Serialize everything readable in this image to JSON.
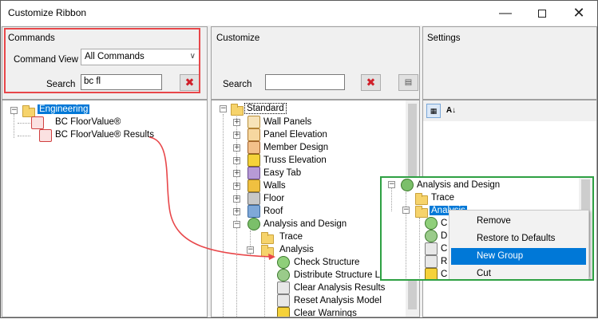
{
  "window": {
    "title": "Customize Ribbon",
    "min_icon": "minimize-icon",
    "max_icon": "maximize-icon",
    "close_icon": "close-icon"
  },
  "commands": {
    "header": "Commands",
    "command_view_label": "Command View",
    "command_view_value": "All Commands",
    "search_label": "Search",
    "search_value": "bc fl",
    "tree": {
      "root": "Engineering",
      "items": [
        "BC FloorValue®",
        "BC FloorValue® Results"
      ]
    }
  },
  "customize": {
    "header": "Customize",
    "search_label": "Search",
    "search_value": "",
    "tree": {
      "root": "Standard",
      "groups": [
        "Wall Panels",
        "Panel Elevation",
        "Member Design",
        "Truss Elevation",
        "Easy Tab",
        "Walls",
        "Floor",
        "Roof"
      ],
      "analysis_design": "Analysis and Design",
      "trace": "Trace",
      "analysis": "Analysis",
      "analysis_items": [
        "Check Structure",
        "Distribute Structure Loa",
        "Clear Analysis Results",
        "Reset Analysis Model",
        "Clear Warnings"
      ]
    }
  },
  "settings": {
    "header": "Settings"
  },
  "zoom": {
    "analysis_design": "Analysis and Design",
    "trace": "Trace",
    "analysis": "Analysis",
    "partial_letters": [
      "C",
      "D",
      "C",
      "R",
      "C"
    ]
  },
  "context_menu": {
    "items": [
      "Remove",
      "Restore to Defaults",
      "New Group",
      "Cut"
    ],
    "highlighted_index": 2
  },
  "colors": {
    "accent": "#0078d7",
    "annotation_red": "#e8474a",
    "annotation_green": "#2ea043"
  }
}
